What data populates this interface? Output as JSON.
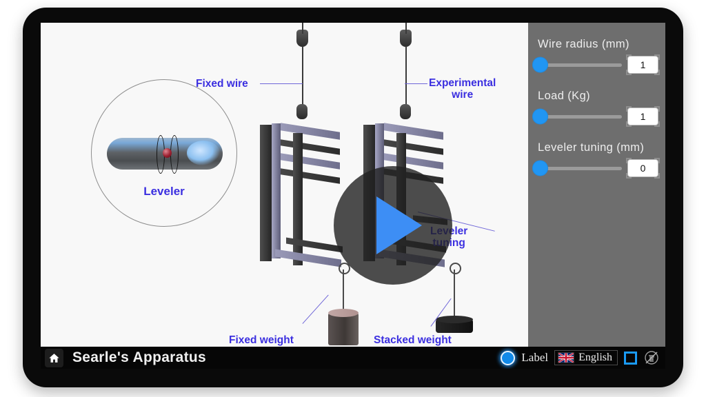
{
  "app": {
    "title": "Searle's Apparatus",
    "home_icon": "home-icon"
  },
  "stage": {
    "play_button_icon": "play-triangle-icon",
    "inset": {
      "caption": "Leveler",
      "device_icon": "spirit-level-capsule"
    },
    "callouts": [
      {
        "id": "fixed-wire",
        "text": "Fixed wire"
      },
      {
        "id": "experimental-wire",
        "text": "Experimental\nwire",
        "line1": "Experimental",
        "line2": "wire"
      },
      {
        "id": "leveler-tuning",
        "text": "Leveler\ntuning",
        "line1": "Leveler",
        "line2": "tuning"
      },
      {
        "id": "fixed-weight",
        "text": "Fixed weight"
      },
      {
        "id": "stacked-weight",
        "text": "Stacked weight"
      }
    ]
  },
  "panel": {
    "background": "#6e6e6e",
    "accent": "#2196f3",
    "controls": [
      {
        "id": "wire-radius",
        "label": "Wire radius (mm)",
        "value": "1",
        "fill_pct": 0
      },
      {
        "id": "load",
        "label": "Load (Kg)",
        "value": "1",
        "fill_pct": 0
      },
      {
        "id": "leveler-tuning",
        "label": "Leveler tuning (mm)",
        "value": "0",
        "fill_pct": 0
      }
    ]
  },
  "bottom_bar": {
    "label_toggle": {
      "text": "Label",
      "state": "on",
      "icon": "radio-on-icon"
    },
    "language": {
      "text": "English",
      "flag": "uk-flag-icon"
    },
    "fullscreen_icon": "fullscreen-icon",
    "brand_icon": "crossed-logo-icon"
  },
  "colors": {
    "label_blue": "#3b2fe0",
    "accent_blue": "#2196f3",
    "bar_black": "#060606",
    "stage_white": "#f8f8f8"
  }
}
